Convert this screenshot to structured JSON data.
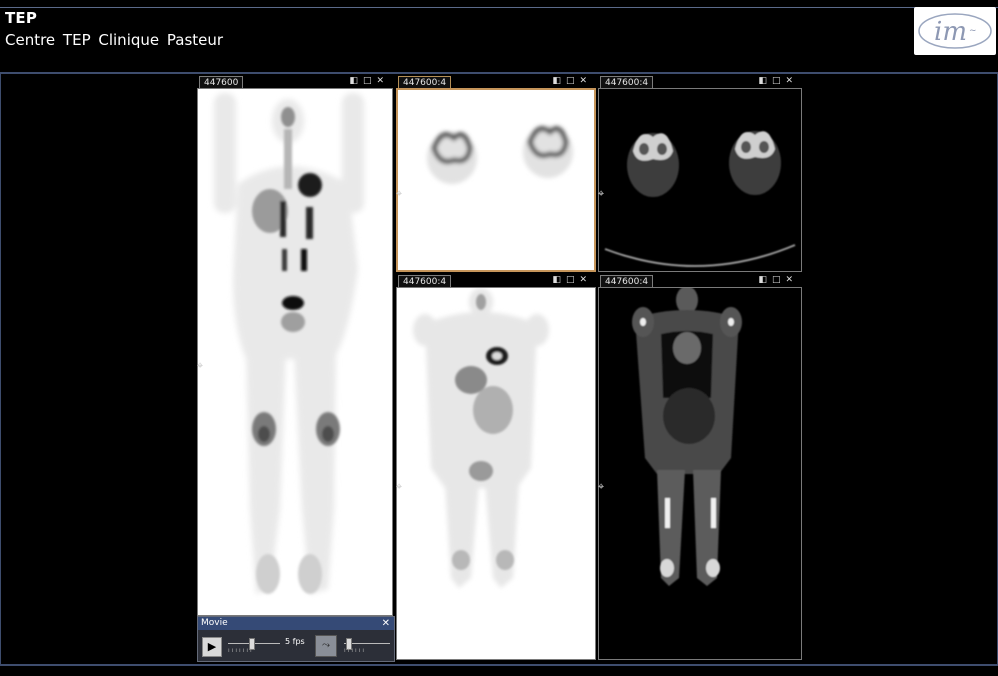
{
  "header": {
    "title": "TEP",
    "subtitle": "Centre TEP Clinique Pasteur",
    "logo_text": "im"
  },
  "viewports": [
    {
      "id": "mip",
      "tab": "447600",
      "bg": "white"
    },
    {
      "id": "pet-axial",
      "tab": "447600:4",
      "bg": "white",
      "active": true
    },
    {
      "id": "ct-axial",
      "tab": "447600:4",
      "bg": "black"
    },
    {
      "id": "pet-coronal",
      "tab": "447600:4",
      "bg": "white"
    },
    {
      "id": "ct-coronal",
      "tab": "447600:4",
      "bg": "black"
    }
  ],
  "viewport_controls": {
    "layout_icon": "◧",
    "maximize_icon": "□",
    "close_icon": "✕"
  },
  "movie": {
    "title": "Movie",
    "close": "✕",
    "play": "▶",
    "fps_label": "5 fps"
  },
  "colors": {
    "accent_frame": "#3e4d6e",
    "active_viewport": "#c6955a",
    "movie_header": "#354a76"
  }
}
